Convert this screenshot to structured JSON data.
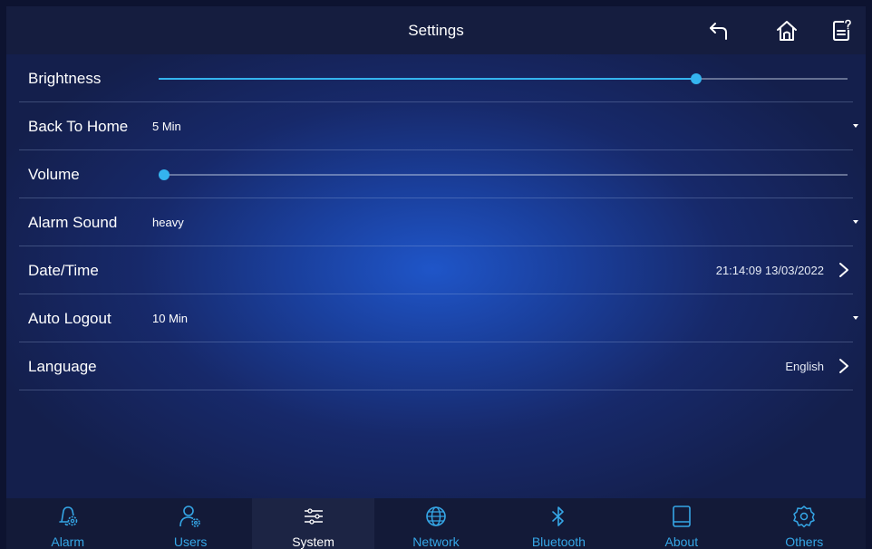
{
  "header": {
    "title": "Settings"
  },
  "settings": {
    "brightness": {
      "label": "Brightness",
      "level": 0.78
    },
    "back_to_home": {
      "label": "Back To Home",
      "value": "5 Min"
    },
    "volume": {
      "label": "Volume",
      "level": 0.0
    },
    "alarm_sound": {
      "label": "Alarm Sound",
      "value": "heavy"
    },
    "date_time": {
      "label": "Date/Time",
      "value": "21:14:09 13/03/2022"
    },
    "auto_logout": {
      "label": "Auto Logout",
      "value": "10 Min"
    },
    "language": {
      "label": "Language",
      "value": "English"
    }
  },
  "tabs": [
    {
      "label": "Alarm",
      "icon": "alarm-gear-icon"
    },
    {
      "label": "Users",
      "icon": "user-gear-icon"
    },
    {
      "label": "System",
      "icon": "sliders-icon"
    },
    {
      "label": "Network",
      "icon": "globe-icon"
    },
    {
      "label": "Bluetooth",
      "icon": "bluetooth-icon"
    },
    {
      "label": "About",
      "icon": "tablet-icon"
    },
    {
      "label": "Others",
      "icon": "gear-icon"
    }
  ],
  "active_tab": "System",
  "colors": {
    "accent": "#34b4ef",
    "tab_label": "#35a6e6",
    "background": "#1a3f9c",
    "bar": "#151d3f"
  }
}
